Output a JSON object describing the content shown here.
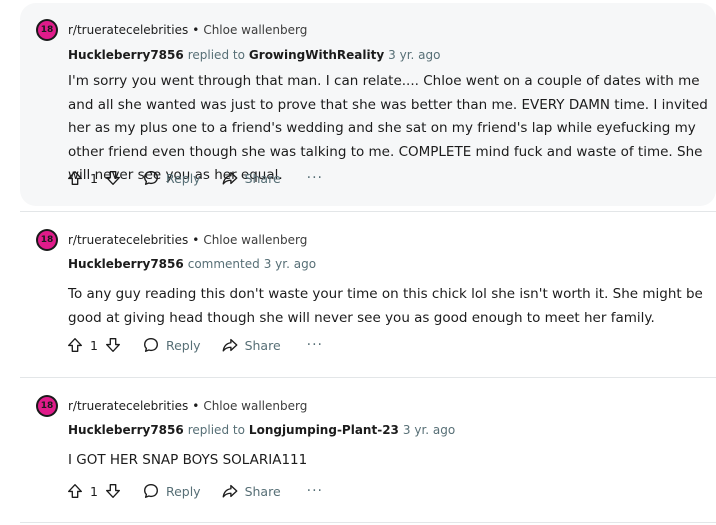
{
  "comments": [
    {
      "badge": "18",
      "subreddit": "r/trueratecelebrities",
      "separator": "•",
      "post_title": "Chloe wallenberg",
      "author": "Huckleberry7856",
      "action": "replied to",
      "target": "GrowingWithReality",
      "age": "3 yr. ago",
      "body": "I'm sorry you went through that man. I can relate.... Chloe went on a couple of dates with me and all she wanted was just to prove that she was better than me. EVERY DAMN time. I invited her as my plus one to a friend's wedding and she sat on my friend's lap while eyefucking my other friend even though she was talking to me. COMPLETE mind fuck and waste of time. She will never see you as her equal.",
      "votes": "1",
      "reply_label": "Reply",
      "share_label": "Share",
      "more_label": "···"
    },
    {
      "badge": "18",
      "subreddit": "r/trueratecelebrities",
      "separator": "•",
      "post_title": "Chloe wallenberg",
      "author": "Huckleberry7856",
      "action": "commented",
      "target": "",
      "age": "3 yr. ago",
      "body": "To any guy reading this don't waste your time on this chick lol she isn't worth it. She might be good at giving head though she will never see you as good enough to meet her family.",
      "votes": "1",
      "reply_label": "Reply",
      "share_label": "Share",
      "more_label": "···"
    },
    {
      "badge": "18",
      "subreddit": "r/trueratecelebrities",
      "separator": "•",
      "post_title": "Chloe wallenberg",
      "author": "Huckleberry7856",
      "action": "replied to",
      "target": "Longjumping-Plant-23",
      "age": "3 yr. ago",
      "body": "I GOT HER SNAP BOYS SOLARIA111",
      "votes": "1",
      "reply_label": "Reply",
      "share_label": "Share",
      "more_label": "···"
    }
  ],
  "icons": {
    "nsfw_badge": "nsfw-18-icon",
    "upvote": "upvote-arrow-icon",
    "downvote": "downvote-arrow-icon",
    "reply": "comment-bubble-icon",
    "share": "share-arrow-icon",
    "more": "ellipsis-icon"
  },
  "colors": {
    "badge_magenta": "#e01b8a",
    "highlight_background": "#f6f7f8",
    "meta_gray": "#576f76",
    "divider": "#e3e6e8"
  }
}
